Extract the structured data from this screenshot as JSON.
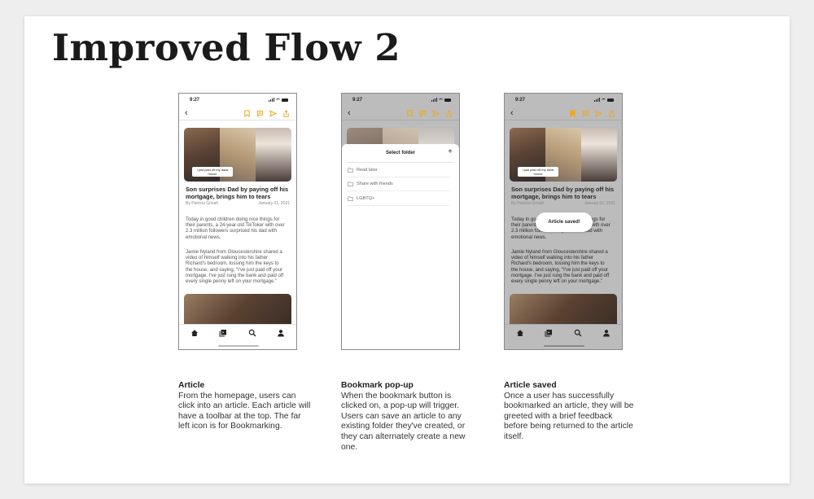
{
  "page": {
    "title": "Improved Flow 2"
  },
  "phone": {
    "time": "9:27",
    "article": {
      "headline": "Son surprises Dad by paying off his mortgage, brings him to tears",
      "byline": "By Patricia Grisafi",
      "date": "January 01, 2021",
      "sticker": "I just paid off my dads house",
      "para1": "Today in good children doing nice things for their parents, a 24-year-old TikToker with over 2.3 million followers surprised his dad with emotional news.",
      "para2": "Jamie Nyland from Gloucestershire shared a video of himself walking into his father Richard's bedroom, tossing him the keys to the house, and saying, \"I've just paid off your mortgage. I've just rung the bank and paid off every single penny left on your mortgage.\""
    },
    "sheet": {
      "title": "Select folder",
      "plus": "+",
      "folders": [
        "Read later",
        "Share with friends",
        "LGBTQ+"
      ]
    },
    "toast": "Article saved!",
    "icons": {
      "back": "chevron-left-icon",
      "toolbar": [
        "bookmark-icon",
        "comment-icon",
        "send-icon",
        "share-icon"
      ],
      "tabbar": [
        "home-icon",
        "library-icon",
        "search-icon",
        "profile-icon"
      ]
    }
  },
  "descriptions": [
    {
      "title": "Article",
      "body": "From the homepage, users can click into an article. Each article will have a toolbar at the top. The far left icon is for Bookmarking."
    },
    {
      "title": "Bookmark pop-up",
      "body": "When the bookmark button is clicked on, a pop-up will trigger. Users can save an article to any existing folder they've created, or they can alternately create a new one."
    },
    {
      "title": "Article saved",
      "body": "Once a user has successfully bookmarked an article, they will be greeted with a brief feedback before being returned to the article itself."
    }
  ],
  "colors": {
    "accent": "#f0a81a",
    "overlay": "#bcbcbc",
    "text": "#1b1b1b"
  }
}
